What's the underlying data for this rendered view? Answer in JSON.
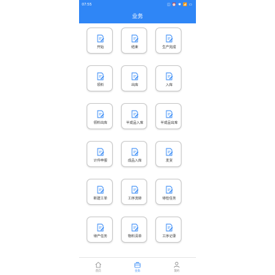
{
  "status_bar": {
    "time": "07:55",
    "icons": "◫ ⏰ ✱ 📶 ▭"
  },
  "header": {
    "title": "业务"
  },
  "tiles": [
    {
      "label": "开始"
    },
    {
      "label": "结束"
    },
    {
      "label": "生产完成"
    },
    {
      "label": "领料"
    },
    {
      "label": "出库"
    },
    {
      "label": "入库"
    },
    {
      "label": "领料出库"
    },
    {
      "label": "半成品入库"
    },
    {
      "label": "半成品出库"
    },
    {
      "label": "计件申报"
    },
    {
      "label": "成品入库"
    },
    {
      "label": "发货"
    },
    {
      "label": "新建工单"
    },
    {
      "label": "工序流转"
    },
    {
      "label": "待检任务"
    },
    {
      "label": "待产任务"
    },
    {
      "label": "物料清单"
    },
    {
      "label": "工序记录"
    }
  ],
  "tabbar": {
    "items": [
      {
        "label": "首页",
        "icon": "home-icon",
        "active": false
      },
      {
        "label": "业务",
        "icon": "briefcase-icon",
        "active": true
      },
      {
        "label": "我的",
        "icon": "user-icon",
        "active": false
      }
    ]
  },
  "colors": {
    "primary": "#2f86f6",
    "tile_border": "#c9c9c9",
    "inactive_tab": "#8a8a8a"
  }
}
